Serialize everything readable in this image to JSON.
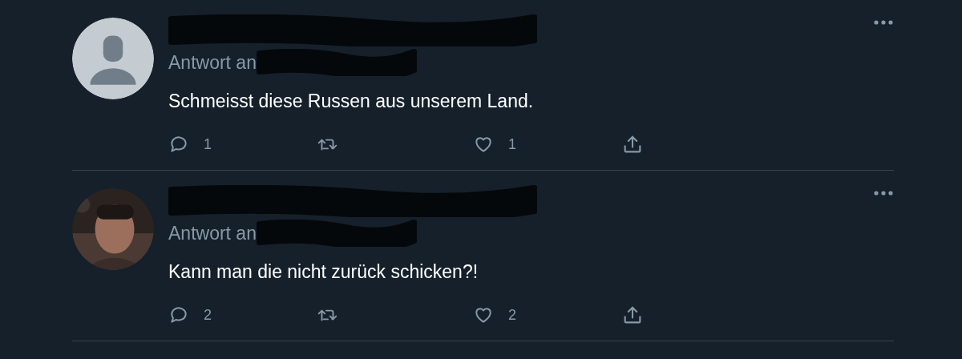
{
  "tweets": [
    {
      "avatar": {
        "kind": "default"
      },
      "reply_label": "Antwort an",
      "text": "Schmeisst diese Russen aus unserem Land.",
      "reply_count": "1",
      "like_count": "1"
    },
    {
      "reply_label": "Antwort an",
      "text": "Kann man die nicht zurück schicken?!",
      "reply_count": "2",
      "like_count": "2"
    }
  ]
}
